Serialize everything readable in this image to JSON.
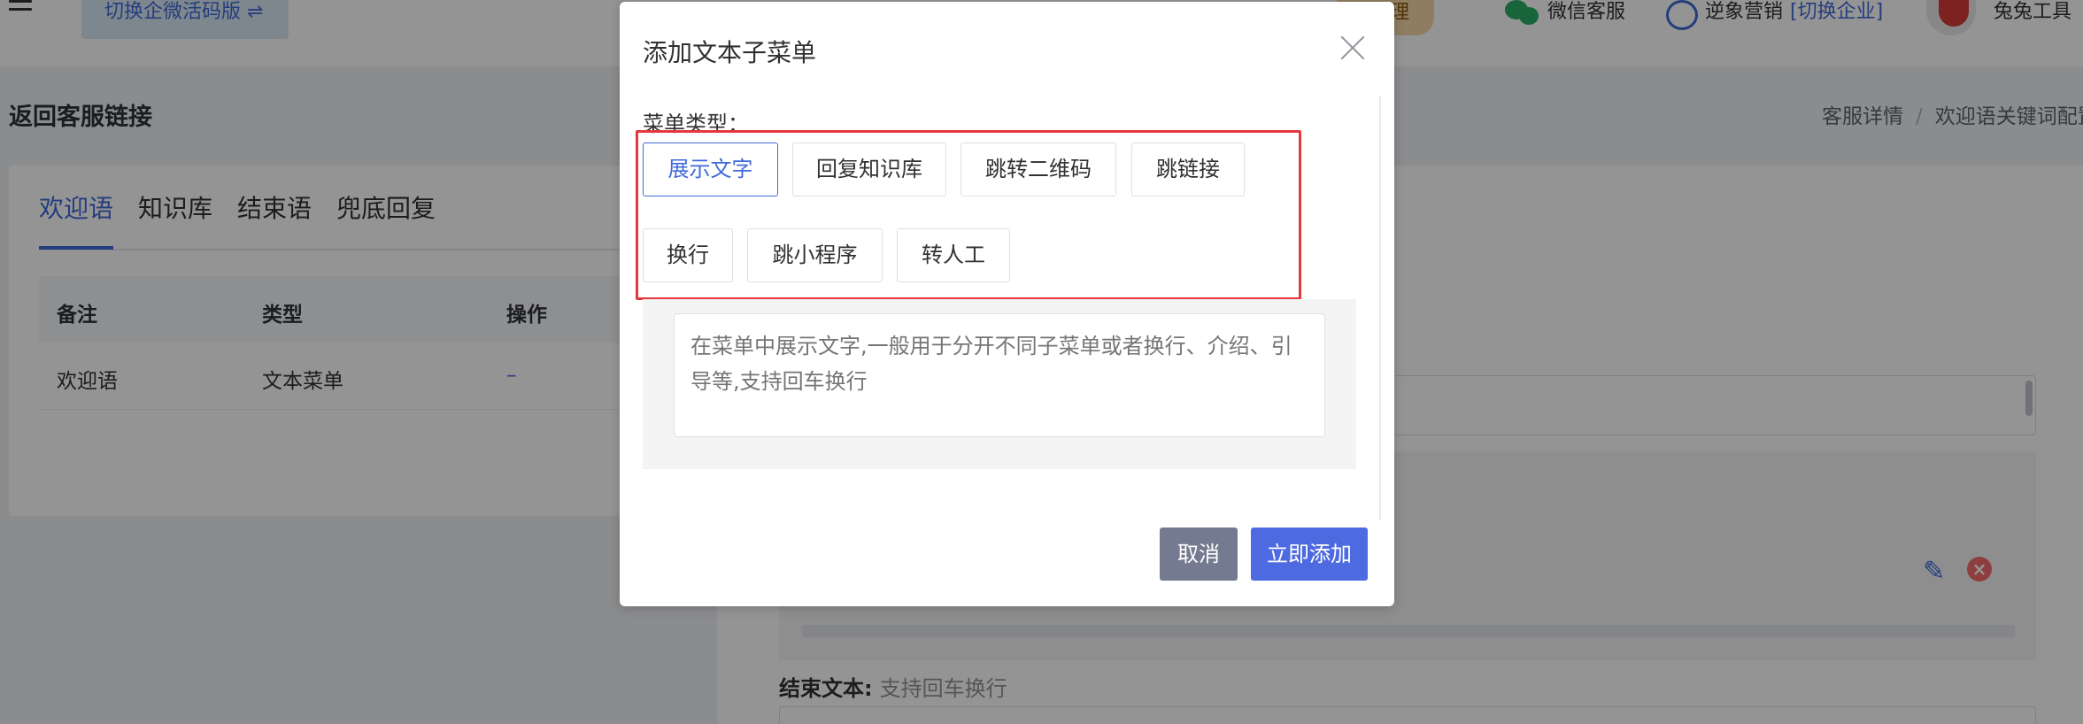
{
  "topbar": {
    "switch_label": "切换企微活码版 ⇌",
    "tab_partial": "理",
    "wechat_service": "微信客服",
    "marketing": "逆象营销",
    "switch_company": "[切换企业]",
    "user_name": "兔兔工具"
  },
  "page": {
    "back_title": "返回客服链接",
    "breadcrumb": [
      "客服详情",
      "欢迎语关键词配置"
    ]
  },
  "left_panel": {
    "tabs": [
      "欢迎语",
      "知识库",
      "结束语",
      "兜底回复"
    ],
    "active_tab": 0,
    "columns": [
      "备注",
      "类型",
      "操作"
    ],
    "rows": [
      {
        "remark": "欢迎语",
        "type": "文本菜单",
        "action": "–"
      }
    ]
  },
  "right_panel": {
    "end_text_label": "结束文本:",
    "end_text_placeholder": "支持回车换行"
  },
  "dialog": {
    "title": "添加文本子菜单",
    "menu_type_label": "菜单类型：",
    "options": [
      "展示文字",
      "回复知识库",
      "跳转二维码",
      "跳链接",
      "换行",
      "跳小程序",
      "转人工"
    ],
    "active_option": "展示文字",
    "description_placeholder": "在菜单中展示文字,一般用于分开不同子菜单或者换行、介绍、引导等,支持回车换行",
    "cancel_label": "取消",
    "confirm_label": "立即添加"
  },
  "colors": {
    "primary": "#3f6ad8",
    "highlight_border": "#e5383b",
    "cancel_button": "#747a8f",
    "confirm_button": "#4e6ae0"
  }
}
